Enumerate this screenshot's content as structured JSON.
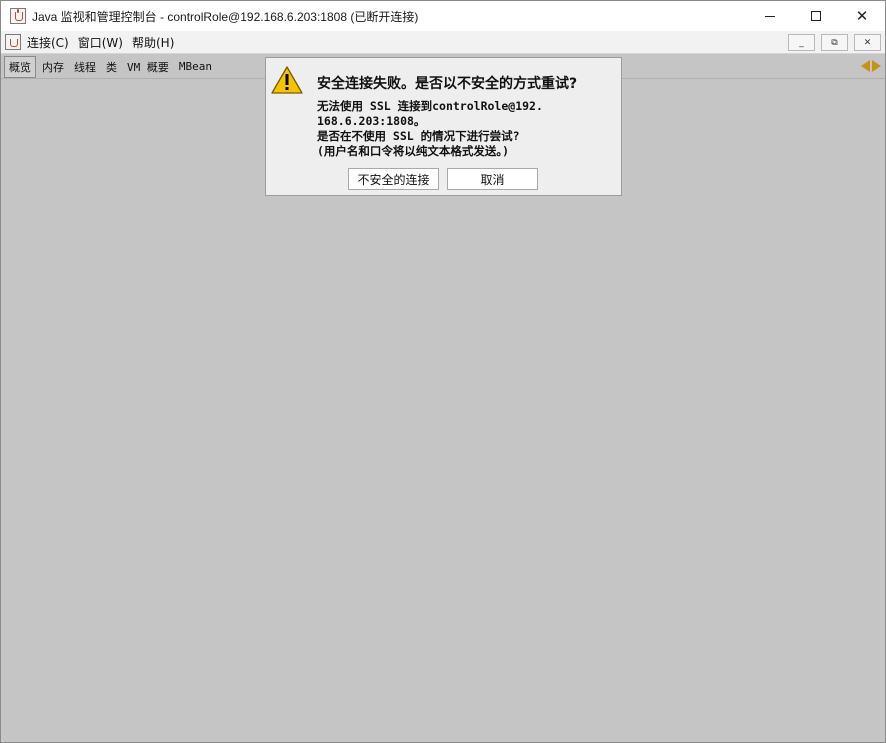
{
  "window": {
    "title": "Java 监视和管理控制台 - controlRole@192.168.6.203:1808 (已断开连接)",
    "controls": {
      "minimize": "minimize",
      "maximize": "maximize",
      "close": "✕"
    }
  },
  "menubar": {
    "items": [
      {
        "label": "连接(C)"
      },
      {
        "label": "窗口(W)"
      },
      {
        "label": "帮助(H)"
      }
    ],
    "inner_controls": {
      "minimize": "_",
      "restore": "⧉",
      "close": "✕"
    }
  },
  "tabs": [
    {
      "label": "概览",
      "selected": true
    },
    {
      "label": "内存"
    },
    {
      "label": "线程"
    },
    {
      "label": "类"
    },
    {
      "label": "VM 概要"
    },
    {
      "label": "MBean"
    }
  ],
  "dialog": {
    "title": "安全连接失败。是否以不安全的方式重试?",
    "lines": [
      "无法使用 SSL 连接到controlRole@192.",
      "168.6.203:1808。",
      "是否在不使用 SSL 的情况下进行尝试?",
      "(用户名和口令将以纯文本格式发送。)"
    ],
    "buttons": {
      "insecure": "不安全的连接",
      "cancel": "取消"
    }
  },
  "icons": {
    "app": "java-app-icon",
    "warning": "warning-icon",
    "nav": "tab-scroll-arrows-icon"
  },
  "colors": {
    "content_bg": "#c5c5c5",
    "dialog_bg": "#eeeeee",
    "warning_yellow": "#f5c400",
    "arrow_gold": "#c89117"
  }
}
